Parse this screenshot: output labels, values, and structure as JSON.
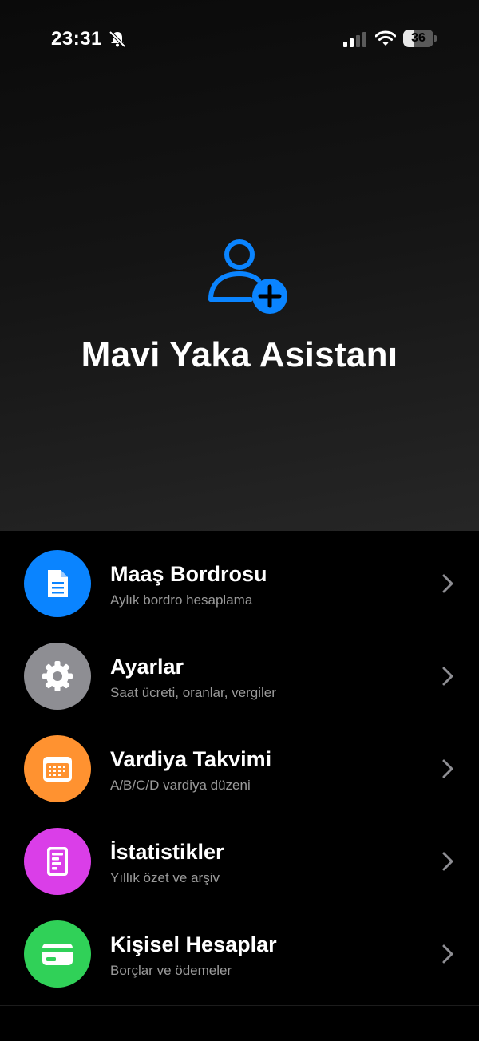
{
  "status_bar": {
    "time": "23:31",
    "battery": "36",
    "battery_level_percent": 36
  },
  "app": {
    "title": "Mavi Yaka Asistanı",
    "header_icon": "person-add-icon",
    "accent": "#0A84FF"
  },
  "menu": [
    {
      "title": "Maaş Bordrosu",
      "subtitle": "Aylık bordro hesaplama",
      "icon": "document-icon",
      "color": "#0A84FF"
    },
    {
      "title": "Ayarlar",
      "subtitle": "Saat ücreti, oranlar, vergiler",
      "icon": "gear-icon",
      "color": "#8E8E93"
    },
    {
      "title": "Vardiya Takvimi",
      "subtitle": "A/B/C/D vardiya düzeni",
      "icon": "calendar-icon",
      "color": "#FF9230"
    },
    {
      "title": "İstatistikler",
      "subtitle": "Yıllık özet ve arşiv",
      "icon": "stats-report-icon",
      "color": "#DA3EE8"
    },
    {
      "title": "Kişisel Hesaplar",
      "subtitle": "Borçlar ve ödemeler",
      "icon": "credit-card-icon",
      "color": "#30D158"
    }
  ]
}
